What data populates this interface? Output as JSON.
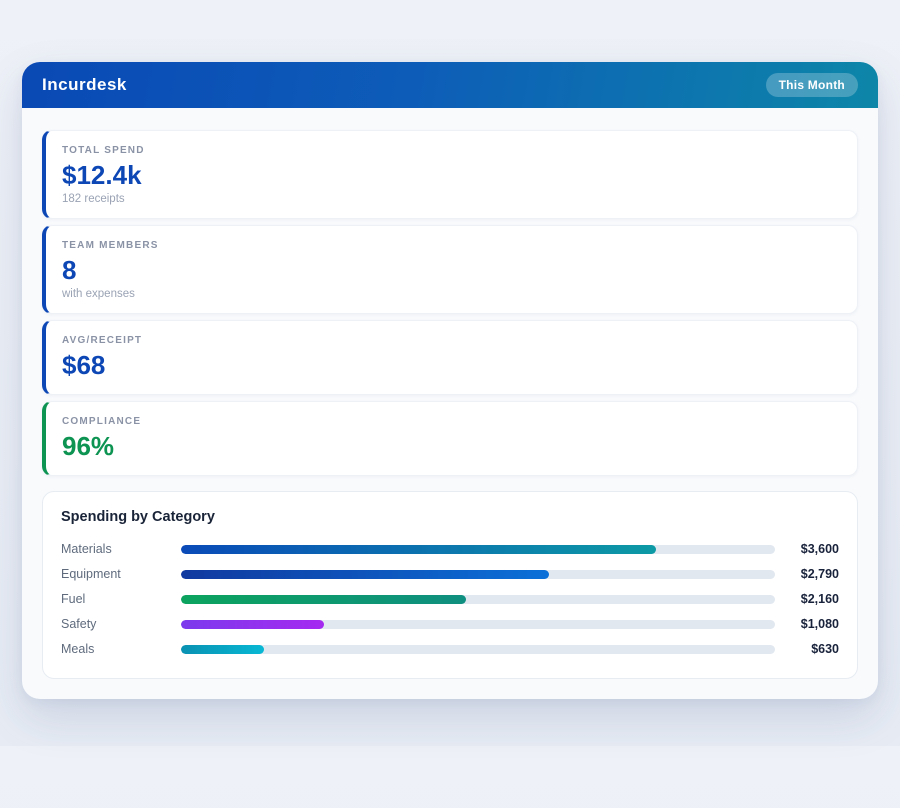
{
  "header": {
    "app_title": "Incurdesk",
    "period_badge": "This Month"
  },
  "stats": [
    {
      "label": "TOTAL SPEND",
      "value": "$12.4k",
      "caption": "182 receipts",
      "accent": "#0d47b5"
    },
    {
      "label": "TEAM MEMBERS",
      "value": "8",
      "caption": "with expenses",
      "accent": "#0d47b5"
    },
    {
      "label": "AVG/RECEIPT",
      "value": "$68",
      "caption": "",
      "accent": "#0d47b5"
    },
    {
      "label": "COMPLIANCE",
      "value": "96%",
      "caption": "",
      "accent": "#0d9352"
    }
  ],
  "chart": {
    "title": "Spending by Category"
  },
  "chart_data": {
    "type": "bar",
    "orientation": "horizontal",
    "title": "Spending by Category",
    "categories": [
      "Materials",
      "Equipment",
      "Fuel",
      "Safety",
      "Meals"
    ],
    "values": [
      3600,
      2790,
      2160,
      1080,
      630
    ],
    "value_labels": [
      "$3,600",
      "$2,790",
      "$2,160",
      "$1,080",
      "$630"
    ],
    "xlim": [
      0,
      4500
    ],
    "grid": false,
    "legend": false,
    "track_color": "#e2e8f0",
    "bar_gradients": [
      [
        "#0a4ab8",
        "#0d9aa5"
      ],
      [
        "#10399f",
        "#0b70d8"
      ],
      [
        "#0ca35e",
        "#0f8f80"
      ],
      [
        "#7c3aed",
        "#a529f0"
      ],
      [
        "#0991b2",
        "#08b8d4"
      ]
    ]
  },
  "colors": {
    "header_gradient_start": "#0a49b5",
    "header_gradient_end": "#0d86a8",
    "page_bg": "#ebeff6",
    "panel_bg": "#f8fafc",
    "accent_blue": "#0d47b5",
    "accent_green": "#0d9352"
  }
}
